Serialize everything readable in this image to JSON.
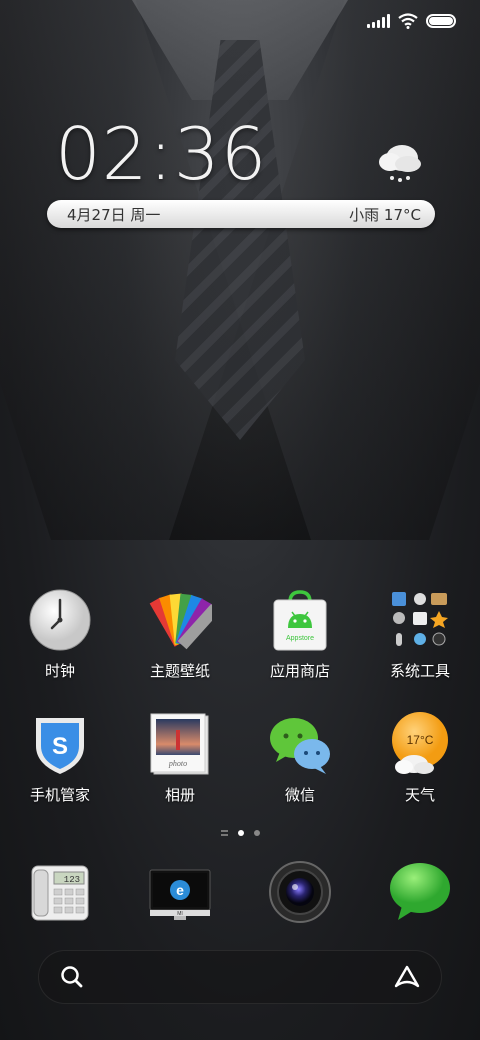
{
  "status_bar": {
    "icons": [
      "signal-icon",
      "wifi-icon",
      "battery-icon"
    ]
  },
  "clock": {
    "time": "02:36"
  },
  "weather": {
    "date": "4月27日 周一",
    "summary": "小雨 17°C",
    "icon": "cloud-rain-icon"
  },
  "apps_row1": [
    {
      "label": "时钟",
      "icon": "clock-icon"
    },
    {
      "label": "主题壁纸",
      "icon": "theme-palette-icon"
    },
    {
      "label": "应用商店",
      "icon": "app-store-icon",
      "badge_text": "Appstore"
    },
    {
      "label": "系统工具",
      "icon": "system-tools-folder-icon"
    }
  ],
  "apps_row2": [
    {
      "label": "手机管家",
      "icon": "security-shield-icon",
      "badge_text": "S"
    },
    {
      "label": "相册",
      "icon": "gallery-photo-icon",
      "badge_text": "photo"
    },
    {
      "label": "微信",
      "icon": "wechat-icon"
    },
    {
      "label": "天气",
      "icon": "weather-sun-icon",
      "badge_text": "17°C"
    }
  ],
  "page_indicator": {
    "pages": 2,
    "active": 0
  },
  "dock": [
    {
      "icon": "phone-icon",
      "display_text": "123"
    },
    {
      "icon": "browser-icon",
      "display_text": "MI"
    },
    {
      "icon": "camera-icon"
    },
    {
      "icon": "messages-icon"
    }
  ],
  "search": {
    "icons": [
      "search-icon",
      "assistant-icon"
    ]
  },
  "colors": {
    "accent_green": "#3ec63e",
    "weather_orange": "#f6a623",
    "shield_blue": "#3a8ee6"
  }
}
